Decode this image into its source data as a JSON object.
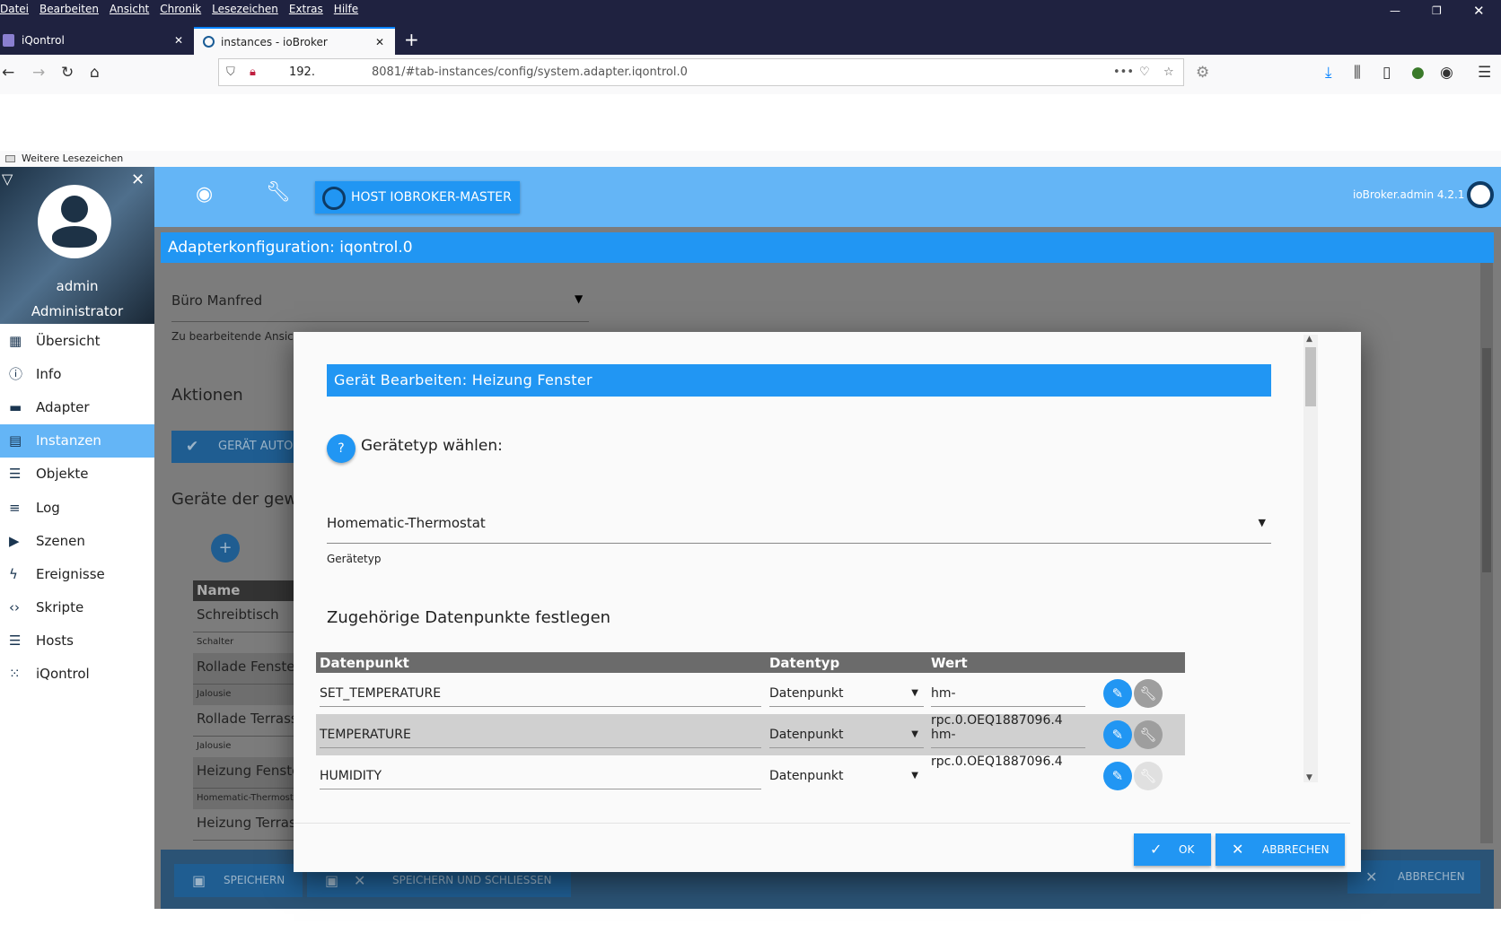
{
  "browser": {
    "menu": [
      "Datei",
      "Bearbeiten",
      "Ansicht",
      "Chronik",
      "Lesezeichen",
      "Extras",
      "Hilfe"
    ],
    "tabs": [
      {
        "label": "iQontrol"
      },
      {
        "label": "instances - ioBroker"
      }
    ],
    "url_host": "192.",
    "url_path": "8081/#tab-instances/config/system.adapter.iqontrol.0",
    "bookmarks_label": "Weitere Lesezeichen"
  },
  "sidebar": {
    "user": "admin",
    "role": "Administrator",
    "items": [
      {
        "label": "Übersicht",
        "icon": "grid-icon"
      },
      {
        "label": "Info",
        "icon": "info-icon"
      },
      {
        "label": "Adapter",
        "icon": "store-icon"
      },
      {
        "label": "Instanzen",
        "icon": "instances-icon"
      },
      {
        "label": "Objekte",
        "icon": "list-icon"
      },
      {
        "label": "Log",
        "icon": "log-icon"
      },
      {
        "label": "Szenen",
        "icon": "scenes-icon"
      },
      {
        "label": "Ereignisse",
        "icon": "flash-icon"
      },
      {
        "label": "Skripte",
        "icon": "code-icon"
      },
      {
        "label": "Hosts",
        "icon": "hosts-icon"
      },
      {
        "label": "iQontrol",
        "icon": "iqontrol-icon"
      }
    ],
    "active": "Instanzen"
  },
  "header": {
    "host_button": "HOST IOBROKER-MASTER",
    "version": "ioBroker.admin 4.2.1"
  },
  "config": {
    "title": "Adapterkonfiguration: iqontrol.0",
    "view_select": "Büro Manfred",
    "view_label": "Zu bearbeitende Ansic",
    "actions_heading": "Aktionen",
    "auto_button": "GERÄT AUTO",
    "devices_heading": "Geräte der gew",
    "name_header": "Name",
    "devices": [
      {
        "name": "Schreibtisch",
        "type": "Schalter"
      },
      {
        "name": "Rollade Fenster",
        "type": "Jalousie"
      },
      {
        "name": "Rollade Terrasse",
        "type": "Jalousie"
      },
      {
        "name": "Heizung Fenste",
        "type": "Homematic-Thermosta"
      },
      {
        "name": "Heizung Terrass",
        "type": ""
      }
    ],
    "save": "SPEICHERN",
    "save_close": "SPEICHERN UND SCHLIESSEN",
    "cancel": "ABBRECHEN"
  },
  "dialog": {
    "title": "Gerät Bearbeiten: Heizung Fenster",
    "choose_type": "Gerätetyp wählen:",
    "device_type": "Homematic-Thermostat",
    "device_type_label": "Gerätetyp",
    "datapoints_heading": "Zugehörige Datenpunkte festlegen",
    "columns": [
      "Datenpunkt",
      "Datentyp",
      "Wert",
      ""
    ],
    "rows": [
      {
        "datapoint": "SET_TEMPERATURE",
        "type": "Datenpunkt",
        "value": "hm-rpc.0.OEQ1887096.4"
      },
      {
        "datapoint": "TEMPERATURE",
        "type": "Datenpunkt",
        "value": "hm-rpc.0.OEQ1887096.4"
      },
      {
        "datapoint": "HUMIDITY",
        "type": "Datenpunkt",
        "value": ""
      }
    ],
    "ok": "OK",
    "cancel": "ABBRECHEN"
  },
  "colors": {
    "primary": "#2196f3",
    "header": "#64b5f6",
    "titlebar": "#1f2240"
  }
}
